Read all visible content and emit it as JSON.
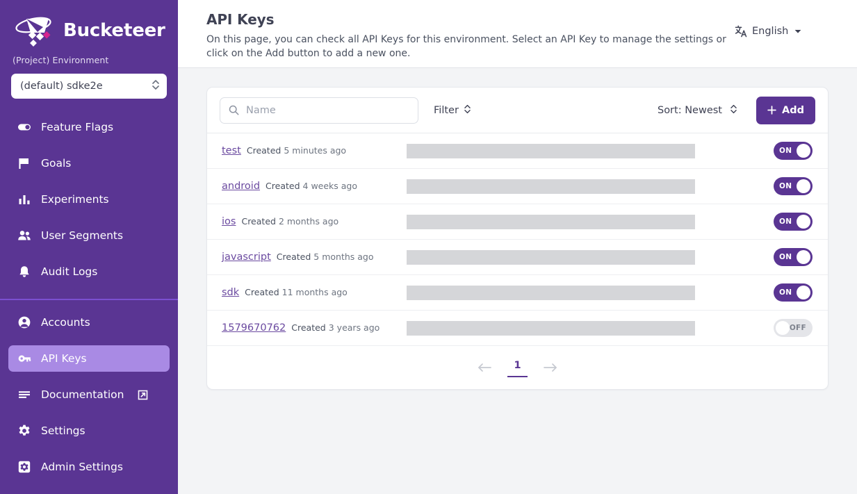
{
  "brand": {
    "name": "Bucketeer",
    "logo_icon": "bucket-logo-icon",
    "accent_purple": "#5a3593",
    "accent_magenta": "#d6248f"
  },
  "sidebar": {
    "env_label": "(Project) Environment",
    "env_selected": "(default) sdke2e",
    "env_chevron_icon": "chevron-updown-icon",
    "items": [
      {
        "label": "Feature Flags",
        "icon": "toggle-icon",
        "active": false
      },
      {
        "label": "Goals",
        "icon": "flag-icon",
        "active": false
      },
      {
        "label": "Experiments",
        "icon": "bar-chart-icon",
        "active": false
      },
      {
        "label": "User Segments",
        "icon": "users-icon",
        "active": false
      },
      {
        "label": "Audit Logs",
        "icon": "bell-icon",
        "active": false
      }
    ],
    "items_bottom": [
      {
        "label": "Accounts",
        "icon": "user-circle-icon",
        "active": false
      },
      {
        "label": "API Keys",
        "icon": "key-icon",
        "active": true
      },
      {
        "label": "Documentation",
        "icon": "document-lines-icon",
        "active": false,
        "external": true,
        "external_icon": "external-link-icon"
      },
      {
        "label": "Settings",
        "icon": "gear-icon",
        "active": false
      },
      {
        "label": "Admin Settings",
        "icon": "admin-gear-icon",
        "active": false
      }
    ]
  },
  "header": {
    "title": "API Keys",
    "description": "On this page, you can check all API Keys for this environment. Select an API Key to manage the settings or click on the Add button to add a new one.",
    "language": "English",
    "language_icon": "translate-icon",
    "language_caret_icon": "caret-down-icon"
  },
  "toolbar": {
    "search_placeholder": "Name",
    "search_value": "",
    "search_icon": "search-icon",
    "filter_label": "Filter",
    "filter_icon": "chevron-updown-icon",
    "sort_label": "Sort: Newest",
    "sort_icon": "chevron-updown-icon",
    "add_label": "Add",
    "add_icon": "plus-icon"
  },
  "api_keys": [
    {
      "name": "test",
      "created_label": "Created",
      "created_time": "5 minutes ago",
      "key_masked": "",
      "state": "ON"
    },
    {
      "name": "android",
      "created_label": "Created",
      "created_time": "4 weeks ago",
      "key_masked": "",
      "state": "ON"
    },
    {
      "name": "ios",
      "created_label": "Created",
      "created_time": "2 months ago",
      "key_masked": "",
      "state": "ON"
    },
    {
      "name": "javascript",
      "created_label": "Created",
      "created_time": "5 months ago",
      "key_masked": "",
      "state": "ON"
    },
    {
      "name": "sdk",
      "created_label": "Created",
      "created_time": "11 months ago",
      "key_masked": "",
      "state": "ON"
    },
    {
      "name": "1579670762",
      "created_label": "Created",
      "created_time": "3 years ago",
      "key_masked": "",
      "state": "OFF"
    }
  ],
  "pagination": {
    "prev_icon": "arrow-left-icon",
    "next_icon": "arrow-right-icon",
    "current_page": "1"
  }
}
